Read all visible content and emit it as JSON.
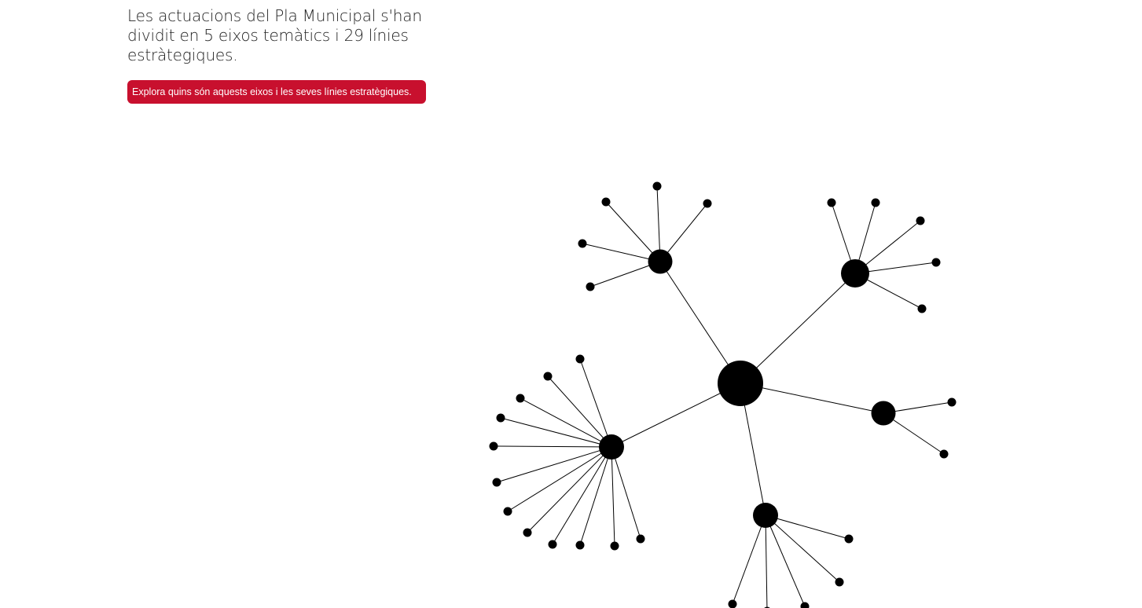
{
  "intro": {
    "text": "Les actuacions del Pla Municipal s'han dividit en 5 eixos temàtics i 29 línies estràtegiques.",
    "button_label": "Explora quins són aquests eixos i les seves línies estratègiques."
  },
  "colors": {
    "button_bg": "#c8102e",
    "node": "#000000",
    "link": "#000000"
  },
  "chart_data": {
    "type": "network",
    "root": "pla-municipal",
    "axes": [
      {
        "id": "eix-1",
        "lines": 5
      },
      {
        "id": "eix-2",
        "lines": 5
      },
      {
        "id": "eix-3",
        "lines": 2
      },
      {
        "id": "eix-4",
        "lines": 12
      },
      {
        "id": "eix-5",
        "lines": 5
      }
    ]
  }
}
